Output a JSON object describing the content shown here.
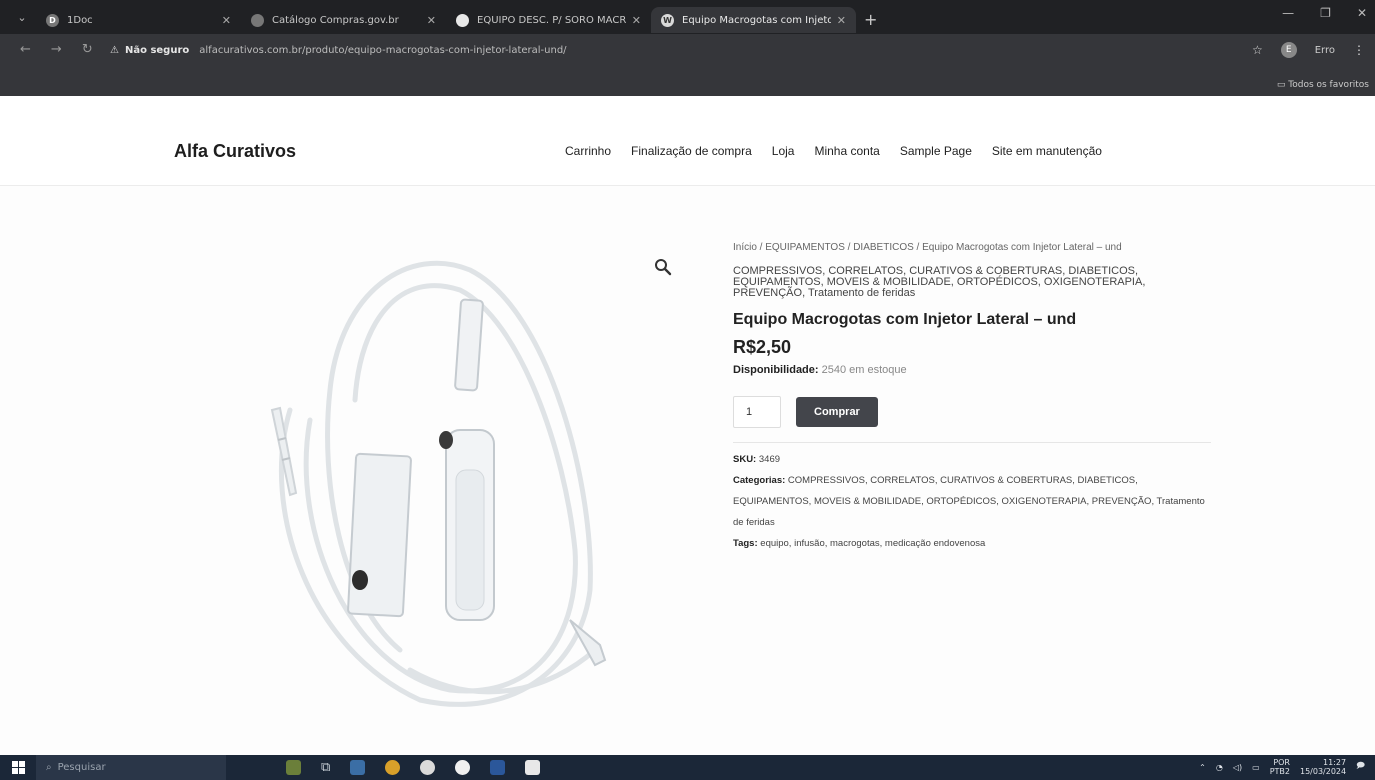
{
  "browser": {
    "tabs": [
      {
        "title": "1Doc",
        "favicon": "D",
        "active": false
      },
      {
        "title": "Catálogo Compras.gov.br",
        "favicon": "",
        "active": false
      },
      {
        "title": "EQUIPO DESC. P/ SORO MACR",
        "favicon": "",
        "active": false
      },
      {
        "title": "Equipo Macrogotas com Injeto",
        "favicon": "W",
        "active": true
      }
    ],
    "new_tab": "+",
    "security_label": "Não seguro",
    "url": "alfacurativos.com.br/produto/equipo-macrogotas-com-injetor-lateral-und/",
    "profile_initial": "E",
    "error_label": "Erro",
    "bookmarks_label": "Todos os favoritos"
  },
  "site": {
    "brand": "Alfa Curativos",
    "nav": [
      "Carrinho",
      "Finalização de compra",
      "Loja",
      "Minha conta",
      "Sample Page",
      "Site em manutenção"
    ]
  },
  "product": {
    "breadcrumb": "Início / EQUIPAMENTOS / DIABETICOS / Equipo Macrogotas com Injetor Lateral – und",
    "categories_line": "COMPRESSIVOS, CORRELATOS, CURATIVOS & COBERTURAS, DIABETICOS, EQUIPAMENTOS, MOVEIS & MOBILIDADE, ORTOPÉDICOS, OXIGENOTERAPIA, PREVENÇÃO, Tratamento de feridas",
    "title": "Equipo Macrogotas com Injetor Lateral – und",
    "price": "R$2,50",
    "availability_label": "Disponibilidade:",
    "availability_value": "2540 em estoque",
    "quantity": "1",
    "buy_label": "Comprar",
    "sku_label": "SKU:",
    "sku_value": "3469",
    "categories_label": "Categorias:",
    "categories_value": "COMPRESSIVOS, CORRELATOS, CURATIVOS & COBERTURAS, DIABETICOS, EQUIPAMENTOS, MOVEIS & MOBILIDADE, ORTOPÉDICOS, OXIGENOTERAPIA, PREVENÇÃO, Tratamento de feridas",
    "tags_label": "Tags:",
    "tags_value": "equipo, infusão, macrogotas, medicação endovenosa"
  },
  "taskbar": {
    "search_placeholder": "Pesquisar",
    "lang_top": "POR",
    "lang_bottom": "PTB2",
    "time": "11:27",
    "date": "15/03/2024"
  },
  "colors": {
    "buy_button": "#43454b",
    "chrome_dark": "#202124",
    "taskbar": "#1b2738"
  }
}
